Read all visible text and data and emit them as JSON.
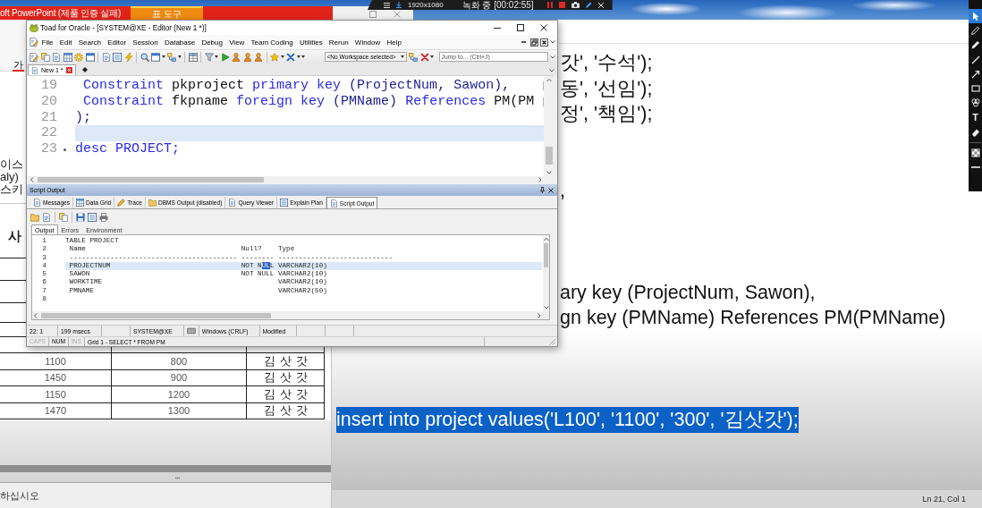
{
  "recorder_bar": {
    "resolution": "1920x1080",
    "status": "녹화 중 [00:02:55]"
  },
  "drawing_toolbar": {
    "tools": [
      {
        "kind": "pointer",
        "selected": true
      },
      {
        "kind": "pen",
        "selected": false
      },
      {
        "kind": "marker",
        "selected": false
      },
      {
        "kind": "line",
        "selected": false
      },
      {
        "kind": "arrow",
        "selected": false
      },
      {
        "kind": "rectangle",
        "selected": false
      },
      {
        "kind": "circles",
        "selected": false
      },
      {
        "kind": "text",
        "label": "T",
        "selected": false
      },
      {
        "kind": "eraser",
        "selected": false
      },
      {
        "kind": "separator"
      },
      {
        "kind": "checker",
        "selected": false
      },
      {
        "kind": "line_width",
        "selected": false
      }
    ]
  },
  "powerpoint": {
    "title": "oft PowerPoint (제품 인증 실패)",
    "context_tab": "표 도구",
    "font_color_button": "가",
    "fragments": [
      "이스",
      "aly)",
      "스키"
    ],
    "heading": "사",
    "table": {
      "rows": [
        [
          "1100",
          "800",
          "김삿갓"
        ],
        [
          "1450",
          "900",
          "김삿갓"
        ],
        [
          "1150",
          "1200",
          "김삿갓"
        ],
        [
          "1470",
          "1300",
          "김삿갓"
        ]
      ]
    },
    "status": "하십시오"
  },
  "toad": {
    "title": "Toad for Oracle - [SYSTEM@XE - Editor (New 1 *)]",
    "menu": [
      "File",
      "Edit",
      "Search",
      "Editor",
      "Session",
      "Database",
      "Debug",
      "View",
      "Team Coding",
      "Utilities",
      "Rerun",
      "Window",
      "Help"
    ],
    "workspace": "<No Workspace selected>",
    "jump": {
      "placeholder": "Jump to... (Ctrl+J)"
    },
    "doc_tabs": [
      {
        "label": "New 1 *",
        "selected": true
      }
    ],
    "editor": {
      "lines": [
        {
          "number": "19",
          "indent": true,
          "current": false,
          "marker": false,
          "tokens": [
            {
              "kind": "keyword",
              "text": "Constraint"
            },
            {
              "kind": "name",
              "text": "pkproject"
            },
            {
              "kind": "keyword",
              "text": "primary key"
            },
            {
              "kind": "symbol",
              "text": "(ProjectNum, Sawon),"
            }
          ]
        },
        {
          "number": "20",
          "indent": true,
          "current": false,
          "marker": false,
          "tokens": [
            {
              "kind": "keyword",
              "text": "Constraint"
            },
            {
              "kind": "name",
              "text": "fkpname"
            },
            {
              "kind": "keyword",
              "text": "foreign key"
            },
            {
              "kind": "symbol",
              "text": "(PMName)"
            },
            {
              "kind": "keyword",
              "text": "References"
            },
            {
              "kind": "name",
              "text": "PM(PM"
            }
          ]
        },
        {
          "number": "21",
          "indent": false,
          "current": false,
          "marker": false,
          "tokens": [
            {
              "kind": "symbol",
              "text": ");"
            }
          ]
        },
        {
          "number": "22",
          "indent": false,
          "current": true,
          "marker": false
        },
        {
          "number": "23",
          "indent": false,
          "current": false,
          "marker": true,
          "tokens": [
            {
              "kind": "keyword",
              "text": "desc"
            },
            {
              "kind": "keyword",
              "text": "PROJECT;"
            }
          ]
        }
      ]
    },
    "output_panel": {
      "title": "Script Output",
      "tabs": [
        {
          "label": "Messages",
          "selected": false
        },
        {
          "label": "Data Grid",
          "selected": false
        },
        {
          "label": "Trace",
          "selected": false
        },
        {
          "label": "DBMS Output (disabled)",
          "selected": false
        },
        {
          "label": "Query Viewer",
          "selected": false
        },
        {
          "label": "Explain Plan",
          "selected": false
        },
        {
          "label": "Script Output",
          "selected": true
        }
      ],
      "subtabs": [
        {
          "label": "Output",
          "selected": true
        },
        {
          "label": "Errors",
          "selected": false
        },
        {
          "label": "Environment",
          "selected": false
        }
      ],
      "lines": [
        {
          "number": "1",
          "kind": "title",
          "text": "TABLE PROJECT",
          "current": false
        },
        {
          "number": "2",
          "kind": "columns",
          "name": "Name",
          "null": [
            {
              "text": "Null?",
              "selected": false
            }
          ],
          "type": "Type",
          "current": false
        },
        {
          "number": "3",
          "kind": "columns",
          "name": "-----------------------------------------",
          "null": [
            {
              "text": "--------",
              "selected": false
            }
          ],
          "type": "----------------------------",
          "current": false
        },
        {
          "number": "4",
          "kind": "columns",
          "name": "PROJECTNUM",
          "null": [
            {
              "text": "NOT N",
              "selected": false
            },
            {
              "text": "UL",
              "selected": true
            },
            {
              "text": "L",
              "selected": false
            }
          ],
          "type": "VARCHAR2(10)",
          "current": true
        },
        {
          "number": "5",
          "kind": "columns",
          "name": "SAWON",
          "null": [
            {
              "text": "NOT NULL",
              "selected": false
            }
          ],
          "type": "VARCHAR2(10)",
          "current": false
        },
        {
          "number": "6",
          "kind": "columns",
          "name": "WORKTIME",
          "type": "VARCHAR2(10)",
          "current": false
        },
        {
          "number": "7",
          "kind": "columns",
          "name": "PMNAME",
          "type": "VARCHAR2(50)",
          "current": false
        },
        {
          "number": "8",
          "kind": "blank",
          "current": false
        }
      ]
    },
    "status_bar": {
      "cells": [
        {
          "kind": "text",
          "text": "22: 1"
        },
        {
          "kind": "text",
          "text": "199 msecs"
        },
        {
          "kind": "empty"
        },
        {
          "kind": "text",
          "text": "SYSTEM@XE"
        },
        {
          "kind": "icon"
        },
        {
          "kind": "text",
          "text": "Windows (CRLF)"
        },
        {
          "kind": "text",
          "text": "Modified"
        },
        {
          "kind": "empty"
        },
        {
          "kind": "empty"
        }
      ]
    },
    "indicators": [
      {
        "label": "CAPS",
        "on": false
      },
      {
        "label": "NUM",
        "on": true
      },
      {
        "label": "INS",
        "on": false
      }
    ],
    "message": "Grid 1 - SELECT * FROM PM"
  },
  "document": {
    "lines": [
      {
        "kind": "clipped",
        "text": "갓', '수석');",
        "selected": false
      },
      {
        "kind": "clipped",
        "text": "동', '선임');",
        "selected": false
      },
      {
        "kind": "clipped",
        "text": "정', '책임');",
        "selected": false
      },
      {
        "kind": "blank"
      },
      {
        "kind": "blank"
      },
      {
        "kind": "clipped",
        "text": ",",
        "selected": false
      },
      {
        "kind": "blank"
      },
      {
        "kind": "blank"
      },
      {
        "kind": "blank"
      },
      {
        "kind": "clipped",
        "text": "ary key (ProjectNum, Sawon),",
        "selected": false
      },
      {
        "kind": "clipped",
        "text": "gn key (PMName) References PM(PMName)",
        "selected": false
      },
      {
        "kind": "blank"
      },
      {
        "kind": "blank"
      },
      {
        "kind": "blank"
      },
      {
        "kind": "full",
        "text": "insert into project values('L100', '1100', '300', '김삿갓');",
        "selected": true
      }
    ],
    "status": "Ln 21, Col 1"
  }
}
